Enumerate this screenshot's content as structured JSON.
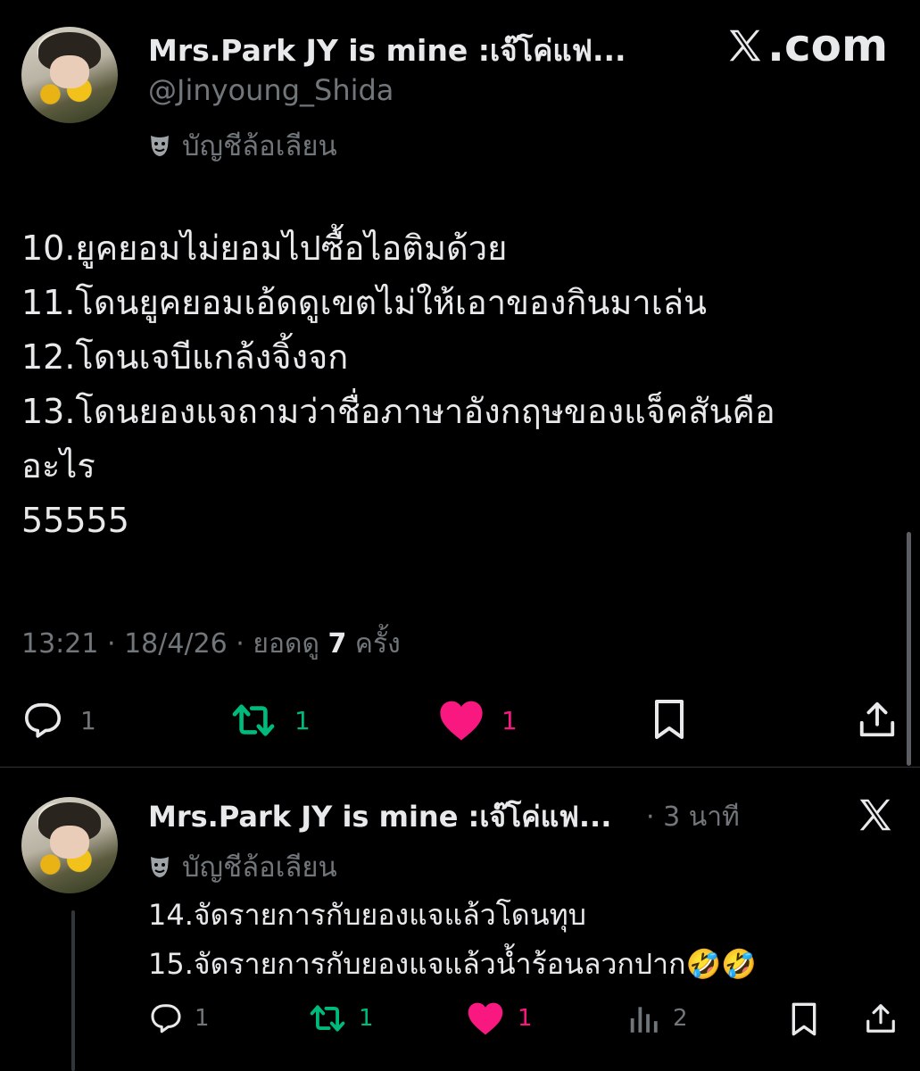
{
  "site": {
    "logo_text": ".com"
  },
  "tweet": {
    "author_name": "Mrs.Park JY is mine :เจ๊โค่แฟ...",
    "handle": "@Jinyoung_Shida",
    "parody_label": "บัญชีล้อเลียน",
    "lines": [
      "10.ยูคยอมไม่ยอมไปซื้อไอติมด้วย",
      "11.โดนยูคยอมเอ้ดดูเขตไม่ให้เอาของกินมาเล่น",
      "12.โดนเจบีแกล้งจิ้งจก",
      "13.โดนยองแจถามว่าชื่อภาษาอังกฤษของแจ็คสันคือ",
      "อะไร",
      "55555"
    ],
    "time": "13:21",
    "date": "18/4/26",
    "views_label_pre": "ยอดดู",
    "views_count": "7",
    "views_label_post": "ครั้ง",
    "replies": "1",
    "reposts": "1",
    "likes": "1"
  },
  "reply": {
    "author_name": "Mrs.Park JY is mine :เจ๊โค่แฟ...",
    "time_ago": "3 นาที",
    "parody_label": "บัญชีล้อเลียน",
    "lines": [
      "14.จัดรายการกับยองแจแล้วโดนทุบ",
      "15.จัดรายการกับยองแจแล้วน้ำร้อนลวกปาก🤣🤣"
    ],
    "replies": "1",
    "reposts": "1",
    "likes": "1",
    "views": "2"
  },
  "colors": {
    "repost": "#00ba7c",
    "like": "#f91880",
    "muted": "#71767b"
  }
}
